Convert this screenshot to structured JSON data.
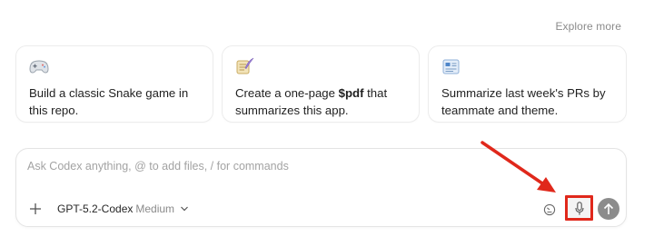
{
  "explore_more": "Explore more",
  "suggestions": [
    {
      "icon": "gamepad-icon",
      "text": "Build a classic Snake game in this repo."
    },
    {
      "icon": "scroll-quill-icon",
      "text_before": "Create a one-page ",
      "text_bold": "$pdf",
      "text_after": " that summarizes this app."
    },
    {
      "icon": "document-card-icon",
      "text": "Summarize last week's PRs by teammate and theme."
    }
  ],
  "composer": {
    "placeholder": "Ask Codex anything, @ to add files, / for commands",
    "value": "",
    "model": "GPT-5.2-Codex",
    "effort": "Medium"
  },
  "colors": {
    "annotation": "#e0281b",
    "send_button": "#8c8c8c",
    "placeholder": "#a3a3a3"
  },
  "icons": [
    "plus-icon",
    "chevron-down-icon",
    "gauge-icon",
    "microphone-icon",
    "arrow-up-icon"
  ]
}
